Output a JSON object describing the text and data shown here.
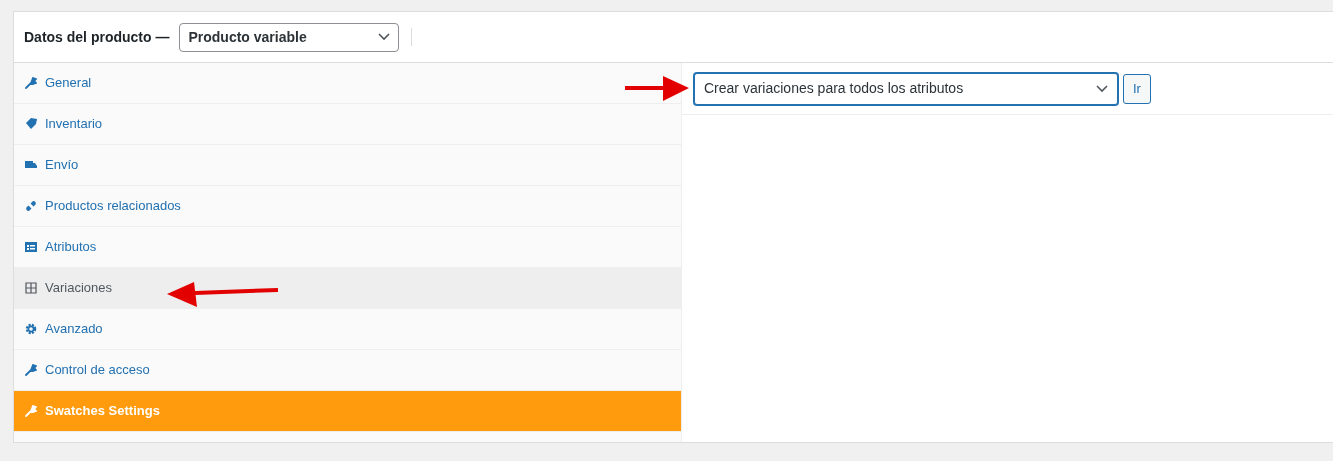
{
  "header": {
    "title": "Datos del producto —",
    "product_type": "Producto variable"
  },
  "tabs": [
    {
      "label": "General",
      "selected": false,
      "kind": "normal"
    },
    {
      "label": "Inventario",
      "selected": false,
      "kind": "normal"
    },
    {
      "label": "Envío",
      "selected": false,
      "kind": "normal"
    },
    {
      "label": "Productos relacionados",
      "selected": false,
      "kind": "normal"
    },
    {
      "label": "Atributos",
      "selected": false,
      "kind": "normal"
    },
    {
      "label": "Variaciones",
      "selected": true,
      "kind": "normal"
    },
    {
      "label": "Avanzado",
      "selected": false,
      "kind": "normal"
    },
    {
      "label": "Control de acceso",
      "selected": false,
      "kind": "normal"
    },
    {
      "label": "Swatches Settings",
      "selected": false,
      "kind": "accent"
    }
  ],
  "variations": {
    "action": "Crear variaciones para todos los atributos",
    "go_button": "Ir"
  }
}
